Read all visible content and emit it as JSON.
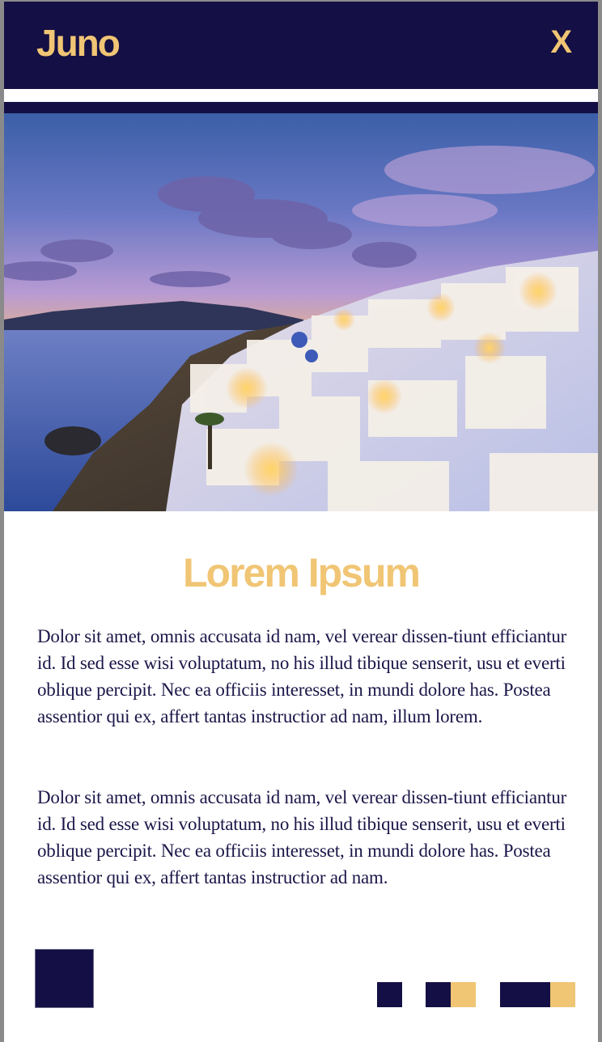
{
  "header": {
    "brand": "Juno",
    "close_label": "X"
  },
  "colors": {
    "navy": "#140f44",
    "gold": "#f0c574",
    "text": "#1a1648"
  },
  "hero": {
    "icon": "santorini-sunset-photo"
  },
  "article": {
    "title": "Lorem Ipsum",
    "paragraphs": [
      "Dolor sit amet, omnis accusata id nam, vel verear dissen-tiunt efficiantur id. Id sed esse wisi voluptatum, no his illud tibique senserit, usu et everti oblique percipit. Nec ea officiis interesset, in mundi dolore has. Postea assentior qui ex, affert tantas instructior ad nam, illum lorem.",
      "Dolor sit amet, omnis accusata id nam, vel verear dissen-tiunt efficiantur id. Id sed esse wisi voluptatum, no his illud tibique senserit, usu et everti oblique percipit. Nec ea officiis interesset, in mundi dolore has. Postea assentior qui ex, affert tantas instructior ad nam."
    ]
  },
  "footer": {
    "pagers": [
      {
        "name": "pager-1",
        "squares": [
          "navy"
        ]
      },
      {
        "name": "pager-2",
        "squares": [
          "navy",
          "gold"
        ]
      },
      {
        "name": "pager-3",
        "squares": [
          "navy",
          "navy",
          "gold"
        ]
      }
    ]
  }
}
